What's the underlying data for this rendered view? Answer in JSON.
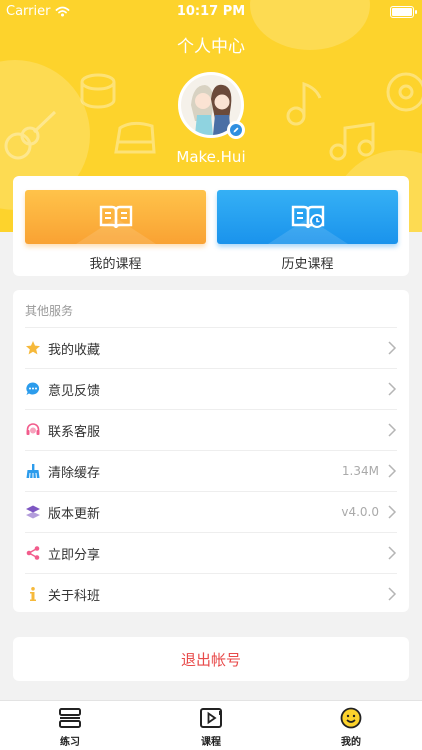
{
  "status_bar": {
    "carrier": "Carrier",
    "time": "10:17 PM"
  },
  "header": {
    "title": "个人中心",
    "username": "Make.Hui",
    "accent": "#fdd32c"
  },
  "courses": {
    "my_courses": "我的课程",
    "history_courses": "历史课程"
  },
  "services": {
    "title": "其他服务",
    "items": [
      {
        "label": "我的收藏",
        "icon": "star-icon",
        "value": ""
      },
      {
        "label": "意见反馈",
        "icon": "chat-bubble-icon",
        "value": ""
      },
      {
        "label": "联系客服",
        "icon": "headset-icon",
        "value": ""
      },
      {
        "label": "清除缓存",
        "icon": "broom-icon",
        "value": "1.34M"
      },
      {
        "label": "版本更新",
        "icon": "layers-icon",
        "value": "v4.0.0"
      },
      {
        "label": "立即分享",
        "icon": "share-icon",
        "value": ""
      },
      {
        "label": "关于科班",
        "icon": "info-icon",
        "value": ""
      }
    ]
  },
  "logout_label": "退出帐号",
  "tabs": [
    {
      "label": "练习",
      "icon": "practice-icon"
    },
    {
      "label": "课程",
      "icon": "video-course-icon"
    },
    {
      "label": "我的",
      "icon": "smiley-profile-icon"
    }
  ]
}
